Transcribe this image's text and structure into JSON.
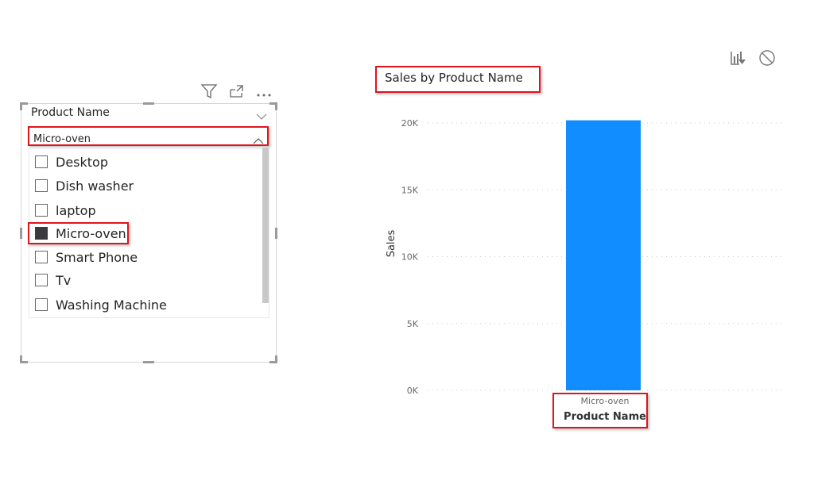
{
  "slicer": {
    "title": "Product Name",
    "selected_value": "Micro-oven",
    "header_icons": [
      "filter-icon",
      "focus-mode-icon",
      "more-options-icon"
    ],
    "items": [
      {
        "label": "Desktop",
        "checked": false
      },
      {
        "label": "Dish washer",
        "checked": false
      },
      {
        "label": "laptop",
        "checked": false
      },
      {
        "label": "Micro-oven",
        "checked": true
      },
      {
        "label": "Smart Phone",
        "checked": false
      },
      {
        "label": "Tv",
        "checked": false
      },
      {
        "label": "Washing Machine",
        "checked": false
      }
    ]
  },
  "visual_icons": [
    "drill-filter-icon",
    "block-icon"
  ],
  "colors": {
    "bar": "#118dff",
    "highlight": "#e0141d"
  },
  "chart_data": {
    "type": "bar",
    "title": "Sales by Product Name",
    "categories": [
      "Micro-oven"
    ],
    "values": [
      20200
    ],
    "xlabel": "Product Name",
    "ylabel": "Sales",
    "ylim": [
      0,
      20000
    ],
    "yticks": [
      0,
      5000,
      10000,
      15000,
      20000
    ],
    "ytick_labels": [
      "0K",
      "5K",
      "10K",
      "15K",
      "20K"
    ],
    "grid": true,
    "legend": "none"
  }
}
